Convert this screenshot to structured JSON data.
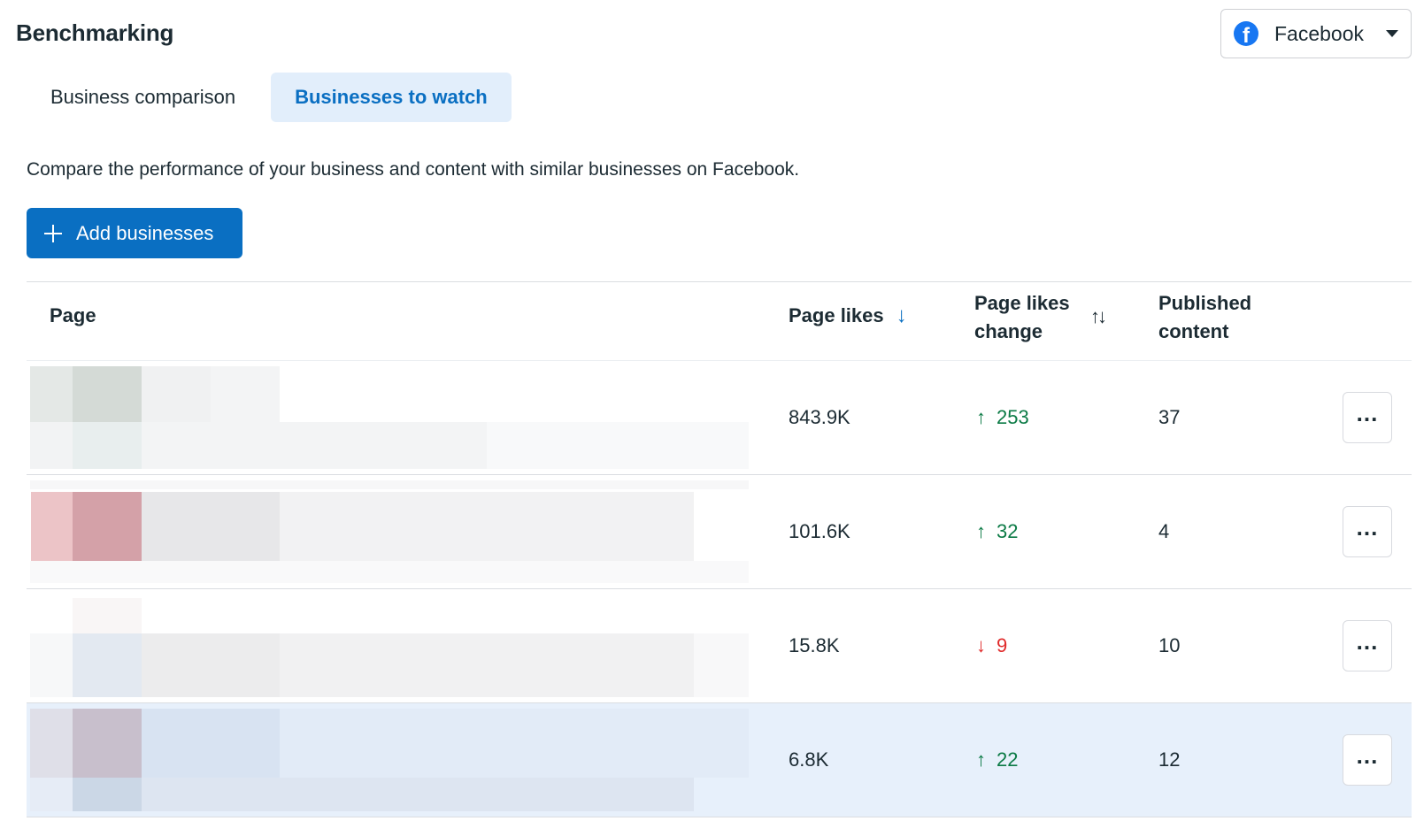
{
  "header": {
    "title": "Benchmarking"
  },
  "platform_select": {
    "label": "Facebook",
    "icon": "facebook-icon",
    "brand_color": "#1877f2"
  },
  "tabs": [
    {
      "label": "Business comparison",
      "active": false
    },
    {
      "label": "Businesses to watch",
      "active": true
    }
  ],
  "description": "Compare the performance of your business and content with similar businesses on Facebook.",
  "add_button": {
    "label": "Add businesses",
    "icon": "plus-icon"
  },
  "table": {
    "columns": {
      "page": "Page",
      "page_likes": "Page likes",
      "page_likes_change": "Page likes change",
      "published_content": "Published content"
    },
    "rows": [
      {
        "page_likes": "843.9K",
        "change": "253",
        "change_dir": "up",
        "published": "37"
      },
      {
        "page_likes": "101.6K",
        "change": "32",
        "change_dir": "up",
        "published": "4"
      },
      {
        "page_likes": "15.8K",
        "change": "9",
        "change_dir": "down",
        "published": "10"
      },
      {
        "page_likes": "6.8K",
        "change": "22",
        "change_dir": "up",
        "published": "12"
      }
    ]
  },
  "colors": {
    "accent": "#0a6fc2",
    "positive": "#0b7a45",
    "negative": "#e02a2a",
    "highlight_row": "#e7f0fb"
  }
}
